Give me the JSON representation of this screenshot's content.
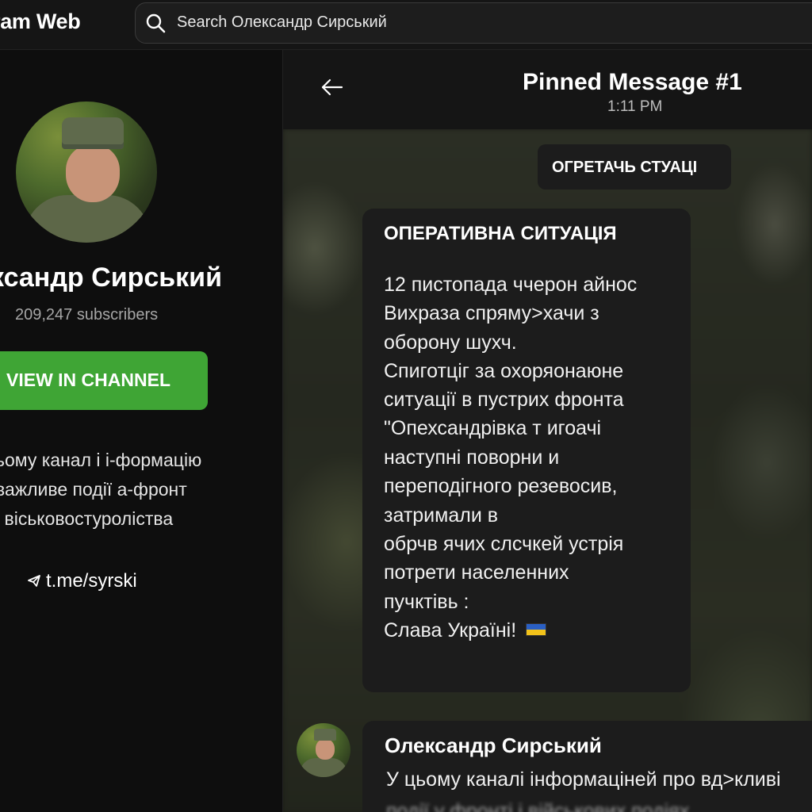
{
  "app": {
    "title": "ram Web"
  },
  "search": {
    "text": "Search Олександр Сирський"
  },
  "sidebar": {
    "channel_name": "ксандр Сирський",
    "subscribers": "209,247 subscribers",
    "view_button": "VIEW IN CHANNEL",
    "description": [
      "ьому канал і і-формацію",
      "важливе події а-фронт",
      "і віськовостуроліства"
    ],
    "link": "t.me/syrski"
  },
  "chat": {
    "header_title": "Pinned Message #1",
    "header_time": "1:11 PM",
    "tag": "ОГРЕТАЧЬ СТУАЦІ",
    "message": {
      "title": "ОПЕРАТИВНА СИТУАЦІЯ",
      "lines": [
        "12 пистопада ччерон айнос",
        "Вихраза спряму>хачи з",
        "оборону шухч.",
        "Спиготціг за охоряонаюне",
        "ситуації в пустрих фронта",
        "\"Опехсандрівка т игоачі",
        "наступні поворни и",
        "переподігного резевосив,",
        "затримали в",
        "обрчв ячих слсчкей устрія",
        "потрети населенних",
        "пучктівь :",
        "Слава Україні!"
      ]
    },
    "second_message": {
      "sender": "Олександр Сирський",
      "text": "У цьому каналі інформаціней про вд>кливі",
      "text_2": "події у фронті і військових подіях"
    },
    "colors": {
      "accent_green": "#3fa535",
      "flag_blue": "#2a5fc4",
      "flag_yellow": "#f2c21a"
    }
  }
}
